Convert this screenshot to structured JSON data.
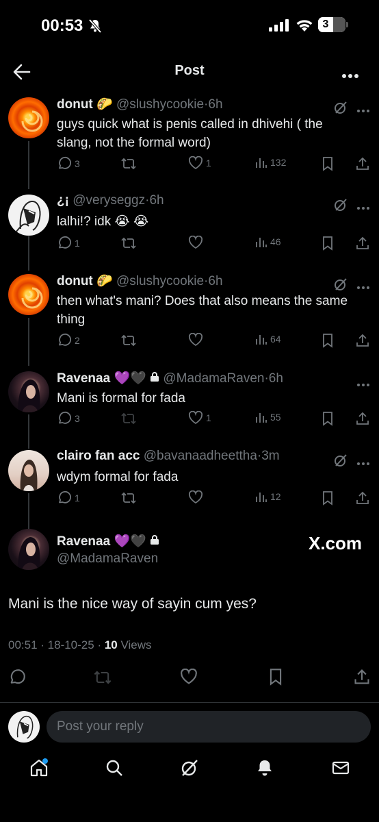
{
  "status": {
    "time": "00:53",
    "battery": "3"
  },
  "header": {
    "title": "Post"
  },
  "thread": [
    {
      "name": "donut 🌮",
      "handle": "@slushycookie",
      "age": "6h",
      "text": "guys quick what is penis called in dhivehi ( the slang, not the formal word)",
      "replies": "3",
      "reposts": "",
      "likes": "1",
      "views": "132"
    },
    {
      "name": "¿¡",
      "handle": "@veryseggz",
      "age": "6h",
      "text": "lalhi!? idk 😭 😭",
      "replies": "1",
      "reposts": "",
      "likes": "",
      "views": "46"
    },
    {
      "name": "donut 🌮",
      "handle": "@slushycookie",
      "age": "6h",
      "text": "then what's mani? Does that also means the same thing",
      "replies": "2",
      "reposts": "",
      "likes": "",
      "views": "64"
    },
    {
      "name": "Ravenaa 💜🖤",
      "handle": "@MadamaRaven",
      "age": "6h",
      "text": "Mani is formal for fada",
      "replies": "3",
      "reposts": "",
      "likes": "1",
      "views": "55"
    },
    {
      "name": "clairo fan acc",
      "handle": "@bavanaadheettha",
      "age": "3m",
      "text": "wdym formal for fada",
      "replies": "1",
      "reposts": "",
      "likes": "",
      "views": "12"
    }
  ],
  "main": {
    "name": "Ravenaa 💜🖤",
    "handle": "@MadamaRaven",
    "watermark": "X.com",
    "text": "Mani is the nice way of sayin cum yes?",
    "time": "00:51",
    "date": "18-10-25",
    "views_count": "10",
    "views_label": "Views"
  },
  "reply": {
    "placeholder": "Post your reply"
  },
  "icons": {
    "accent": "#1d9bf0",
    "muted": "#71767b",
    "nav": [
      "home-icon",
      "search-icon",
      "grok-icon",
      "notifications-icon",
      "messages-icon"
    ]
  }
}
